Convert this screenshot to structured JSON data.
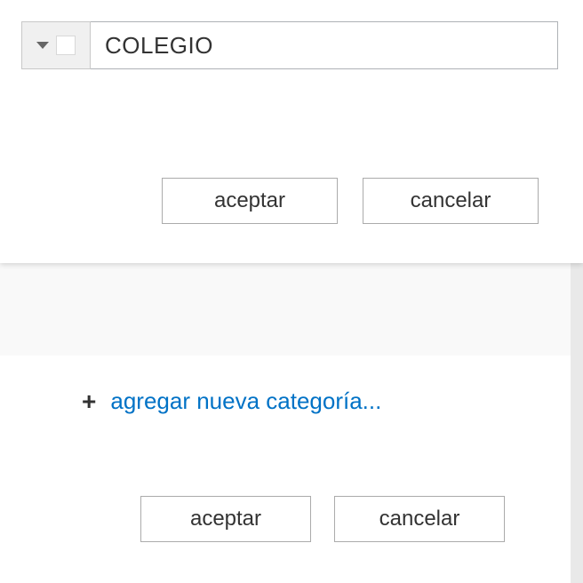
{
  "top_panel": {
    "category_input_value": "COLEGIO",
    "accept_label": "aceptar",
    "cancel_label": "cancelar"
  },
  "bottom_panel": {
    "add_category_label": "agregar nueva categoría...",
    "accept_label": "aceptar",
    "cancel_label": "cancelar"
  }
}
